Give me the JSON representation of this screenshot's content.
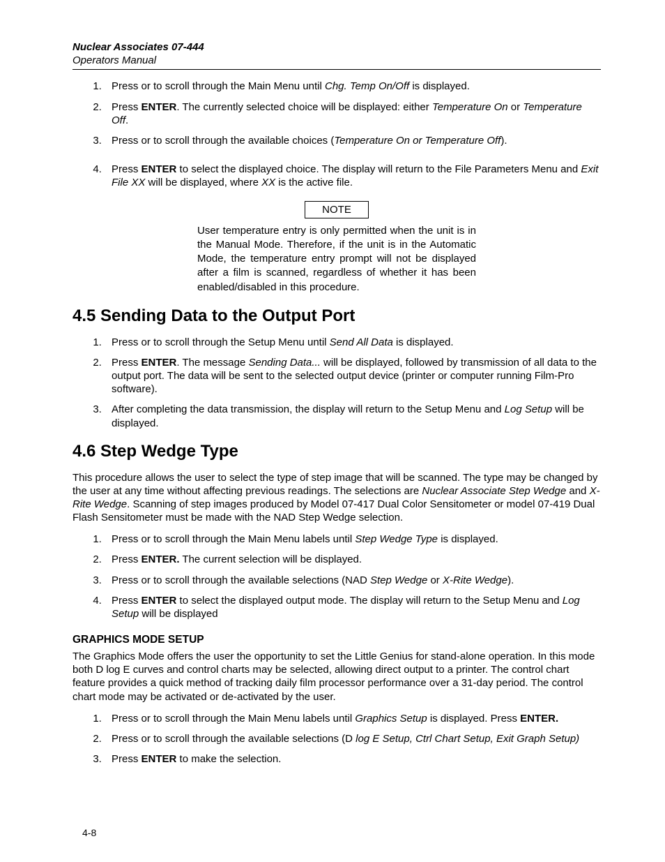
{
  "header": {
    "title": "Nuclear Associates 07-444",
    "subtitle": "Operators Manual"
  },
  "list1": {
    "i1_a": "Press   or   to scroll through the Main Menu until ",
    "i1_b": "Chg. Temp On/Off",
    "i1_c": " is displayed.",
    "i2_a": "Press ",
    "i2_b": "ENTER",
    "i2_c": ".  The currently selected choice will be displayed: either ",
    "i2_d": "Temperature On",
    "i2_e": " or ",
    "i2_f": "Temperature Off",
    "i2_g": ".",
    "i3_a": "Press   or   to scroll through the available choices (",
    "i3_b": "Temperature On or Temperature Off",
    "i3_c": ").",
    "i4_a": "Press ",
    "i4_b": "ENTER",
    "i4_c": " to select the displayed choice.  The display will return to the File Parameters Menu and ",
    "i4_d": "Exit File XX",
    "i4_e": " will be displayed, where ",
    "i4_f": "XX",
    "i4_g": " is the active file."
  },
  "note": {
    "label": "NOTE",
    "text": "User temperature entry is only permitted when the unit is in the Manual Mode.  Therefore, if the unit is in the Automatic Mode, the temperature entry prompt will not be displayed after a film is scanned, regardless of whether it has been enabled/disabled in this procedure."
  },
  "sec45": {
    "heading": "4.5 Sending Data to the Output Port",
    "i1_a": "Press   or   to scroll through the Setup Menu until ",
    "i1_b": "Send All Data",
    "i1_c": " is displayed.",
    "i2_a": "Press ",
    "i2_b": "ENTER",
    "i2_c": ".  The message ",
    "i2_d": "Sending Data...",
    "i2_e": " will be displayed, followed by transmission of all data to the output port.  The data will be sent to the selected output device (printer or computer running Film-Pro software).",
    "i3_a": "After completing the data transmission, the display will return to the Setup Menu and ",
    "i3_b": "Log Setup",
    "i3_c": " will be displayed."
  },
  "sec46": {
    "heading": "4.6 Step Wedge Type",
    "intro_a": "This procedure allows the user to select the type of step image that will be scanned.  The type may be changed by the user at any time without affecting previous readings.  The selections are ",
    "intro_b": "Nuclear Associate Step Wedge",
    "intro_c": " and ",
    "intro_d": "X-Rite Wedge",
    "intro_e": ".  Scanning of step images produced by Model 07-417 Dual Color Sensitometer or model 07-419 Dual Flash Sensitometer must be made with the NAD Step Wedge selection.",
    "i1_a": "Press   or   to scroll through the Main Menu labels until ",
    "i1_b": "Step Wedge Type",
    "i1_c": " is displayed.",
    "i2_a": "Press ",
    "i2_b": "ENTER.",
    "i2_c": "  The current selection will be displayed.",
    "i3_a": "Press   or   to scroll through the available selections (NAD ",
    "i3_b": "Step Wedge",
    "i3_c": " or ",
    "i3_d": "X-Rite Wedge",
    "i3_e": ").",
    "i4_a": "Press ",
    "i4_b": "ENTER",
    "i4_c": " to select the displayed output mode.  The display will return to the Setup Menu and ",
    "i4_d": "Log Setup",
    "i4_e": " will be displayed"
  },
  "graphics": {
    "heading": "GRAPHICS MODE SETUP",
    "intro": "The Graphics Mode offers the user the opportunity to set the Little Genius for stand-alone operation.  In this mode both D log E curves and control charts may be selected, allowing direct output to a printer.  The control chart feature provides a quick method of tracking daily film processor performance over a 31-day period.  The control chart mode may be activated or de-activated by the user.",
    "i1_a": "Press   or   to scroll through the Main Menu labels until ",
    "i1_b": "Graphics Setup",
    "i1_c": " is displayed.  Press ",
    "i1_d": "ENTER.",
    "i2_a": "Press   or   to scroll through the available selections (D ",
    "i2_b": "log E Setup, Ctrl Chart Setup, Exit Graph Setup)",
    "i3_a": "Press ",
    "i3_b": "ENTER",
    "i3_c": " to make the selection."
  },
  "footer": {
    "page": "4-8"
  }
}
